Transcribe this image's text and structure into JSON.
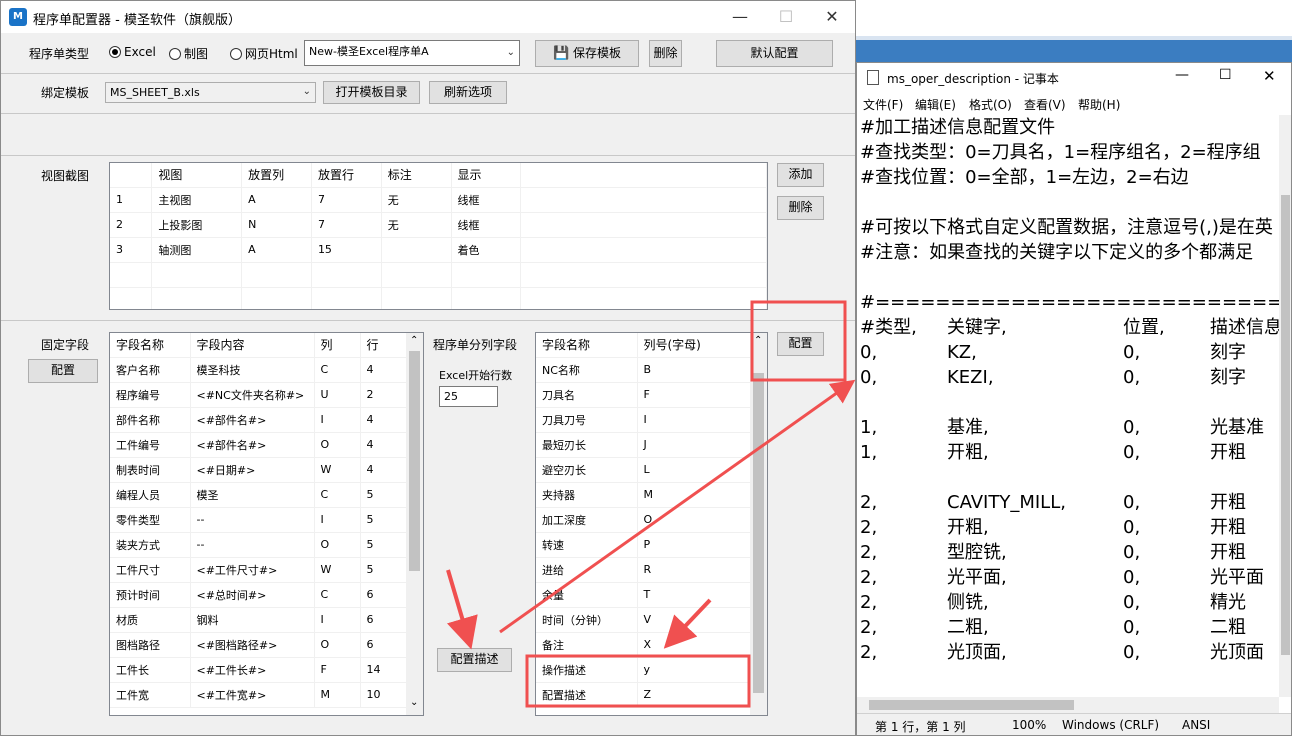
{
  "main_window": {
    "title": "程序单配置器 - 模圣软件（旗舰版）",
    "program_type_label": "程序单类型",
    "radios": [
      {
        "label": "Excel",
        "selected": true
      },
      {
        "label": "制图",
        "selected": false
      },
      {
        "label": "网页Html",
        "selected": false
      }
    ],
    "template_combo_value": "New-模圣Excel程序单A",
    "save_template": "保存模板",
    "delete": "删除",
    "default_config": "默认配置",
    "bind_template_label": "绑定模板",
    "bind_template_value": "MS_SHEET_B.xls",
    "open_template_dir": "打开模板目录",
    "refresh_options": "刷新选项"
  },
  "view_section": {
    "label": "视图截图",
    "add": "添加",
    "delete": "删除",
    "columns": [
      "",
      "视图",
      "放置列",
      "放置行",
      "标注",
      "显示"
    ],
    "rows": [
      [
        "1",
        "主视图",
        "A",
        "7",
        "无",
        "线框"
      ],
      [
        "2",
        "上投影图",
        "N",
        "7",
        "无",
        "线框"
      ],
      [
        "3",
        "轴测图",
        "A",
        "15",
        "",
        "着色"
      ]
    ]
  },
  "fixed_section": {
    "label": "固定字段",
    "config": "配置",
    "columns": [
      "字段名称",
      "字段内容",
      "列",
      "行"
    ],
    "rows": [
      [
        "客户名称",
        "模圣科技",
        "C",
        "4"
      ],
      [
        "程序编号",
        "<#NC文件夹名称#>",
        "U",
        "2"
      ],
      [
        "部件名称",
        "<#部件名#>",
        "I",
        "4"
      ],
      [
        "工件编号",
        "<#部件名#>",
        "O",
        "4"
      ],
      [
        "制表时间",
        "<#日期#>",
        "W",
        "4"
      ],
      [
        "编程人员",
        "模圣",
        "C",
        "5"
      ],
      [
        "零件类型",
        "--",
        "I",
        "5"
      ],
      [
        "装夹方式",
        "--",
        "O",
        "5"
      ],
      [
        "工件尺寸",
        "<#工件尺寸#>",
        "W",
        "5"
      ],
      [
        "预计时间",
        "<#总时间#>",
        "C",
        "6"
      ],
      [
        "材质",
        "钢料",
        "I",
        "6"
      ],
      [
        "图档路径",
        "<#图档路径#>",
        "O",
        "6"
      ],
      [
        "工件长",
        "<#工件长#>",
        "F",
        "14"
      ],
      [
        "工件宽",
        "<#工件宽#>",
        "M",
        "10"
      ]
    ]
  },
  "split_section": {
    "label": "程序单分列字段",
    "excel_start_label": "Excel开始行数",
    "excel_start_value": "25",
    "config_desc": "配置描述",
    "config": "配置",
    "columns": [
      "字段名称",
      "列号(字母)"
    ],
    "rows": [
      [
        "NC名称",
        "B"
      ],
      [
        "刀具名",
        "F"
      ],
      [
        "刀具刀号",
        "I"
      ],
      [
        "最短刃长",
        "J"
      ],
      [
        "避空刃长",
        "L"
      ],
      [
        "夹持器",
        "M"
      ],
      [
        "加工深度",
        "O"
      ],
      [
        "转速",
        "P"
      ],
      [
        "进给",
        "R"
      ],
      [
        "余量",
        "T"
      ],
      [
        "时间（分钟）",
        "V"
      ],
      [
        "备注",
        "X"
      ],
      [
        "操作描述",
        "y"
      ],
      [
        "配置描述",
        "Z"
      ]
    ]
  },
  "notepad": {
    "title": "ms_oper_description - 记事本",
    "menu": [
      "文件(F)",
      "编辑(E)",
      "格式(O)",
      "查看(V)",
      "帮助(H)"
    ],
    "text_lines": [
      "#加工描述信息配置文件",
      "#查找类型：0=刀具名，1=程序组名，2=程序组",
      "#查找位置：0=全部，1=左边，2=右边",
      "",
      "#可按以下格式自定义配置数据，注意逗号(,)是在英",
      "#注意：如果查找的关键字以下定义的多个都满足",
      "",
      "#======================================"
    ],
    "table_lines": [
      [
        "#类型,",
        "关键字,",
        "位置,",
        "描述信息"
      ],
      [
        "0,",
        "KZ,",
        "0,",
        "刻字"
      ],
      [
        "0,",
        "KEZI,",
        "0,",
        "刻字"
      ],
      [
        "",
        "",
        "",
        ""
      ],
      [
        "1,",
        "基准,",
        "0,",
        "光基准"
      ],
      [
        "1,",
        "开粗,",
        "0,",
        "开粗"
      ],
      [
        "",
        "",
        "",
        ""
      ],
      [
        "2,",
        "CAVITY_MILL,",
        "0,",
        "开粗"
      ],
      [
        "2,",
        "开粗,",
        "0,",
        "开粗"
      ],
      [
        "2,",
        "型腔铣,",
        "0,",
        "开粗"
      ],
      [
        "2,",
        "光平面,",
        "0,",
        "光平面"
      ],
      [
        "2,",
        "侧铣,",
        "0,",
        "精光"
      ],
      [
        "2,",
        "二粗,",
        "0,",
        "二粗"
      ],
      [
        "2,",
        "光顶面,",
        "0,",
        "光顶面"
      ]
    ],
    "status": {
      "position": "第 1 行，第 1 列",
      "zoom": "100%",
      "line_ending": "Windows (CRLF)",
      "encoding": "ANSI"
    }
  },
  "colors": {
    "annotation_red": "#f05050",
    "accent_blue": "#3b7dc1"
  }
}
